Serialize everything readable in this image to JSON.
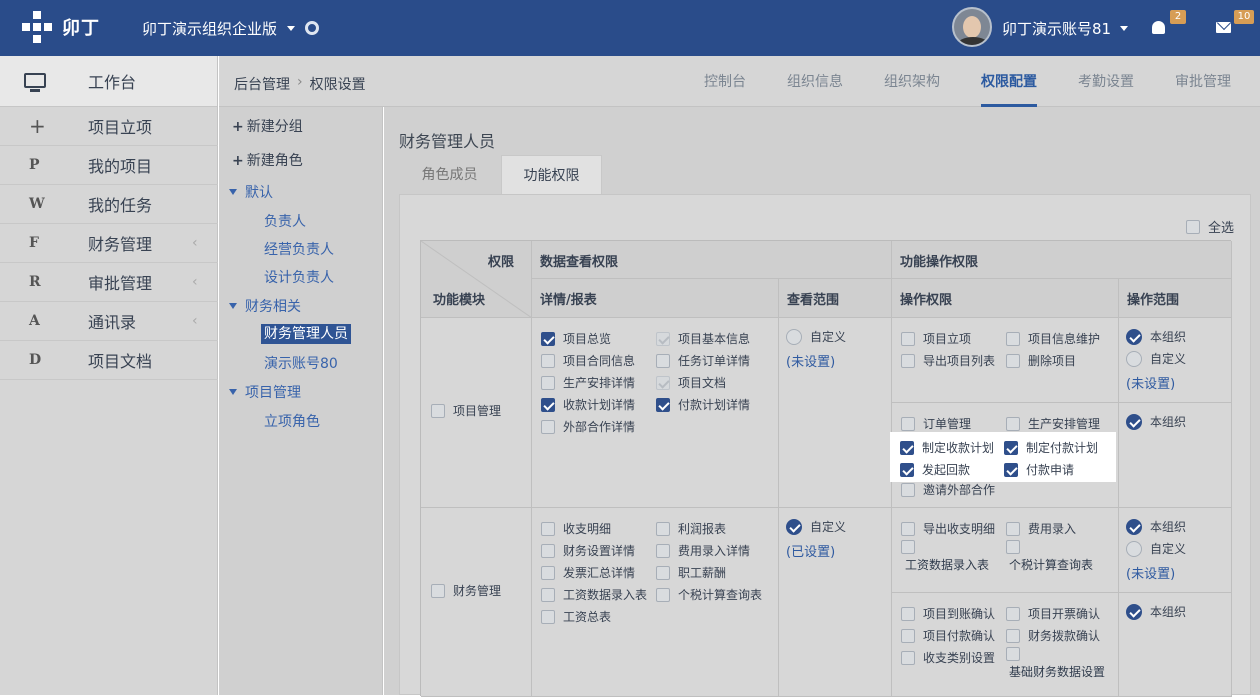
{
  "header": {
    "logo": "卯丁",
    "org": "卯丁演示组织企业版",
    "user": "卯丁演示账号81",
    "badges": {
      "bell": "2",
      "mail": "10"
    }
  },
  "sidebar": {
    "workbench": "工作台",
    "items": [
      {
        "letter": "+",
        "label": "项目立项"
      },
      {
        "letter": "P",
        "label": "我的项目"
      },
      {
        "letter": "W",
        "label": "我的任务"
      },
      {
        "letter": "F",
        "label": "财务管理",
        "caret": "‹"
      },
      {
        "letter": "R",
        "label": "审批管理",
        "caret": "‹"
      },
      {
        "letter": "A",
        "label": "通讯录",
        "caret": "‹"
      },
      {
        "letter": "D",
        "label": "项目文档"
      }
    ]
  },
  "breadcrumb": {
    "root": "后台管理",
    "sep": "›",
    "current": "权限设置"
  },
  "topTabs": [
    "控制台",
    "组织信息",
    "组织架构",
    "权限配置",
    "考勤设置",
    "审批管理"
  ],
  "tree": {
    "newGroup": "新建分组",
    "newRole": "新建角色",
    "groups": [
      {
        "label": "默认",
        "items": [
          "负责人",
          "经营负责人",
          "设计负责人"
        ]
      },
      {
        "label": "财务相关",
        "items": [
          "财务管理人员",
          "演示账号80"
        ]
      },
      {
        "label": "项目管理",
        "items": [
          "立项角色"
        ]
      }
    ]
  },
  "main": {
    "title": "财务管理人员",
    "tabs": [
      "角色成员",
      "功能权限"
    ],
    "selectAll": "全选",
    "headers": {
      "perm": "权限",
      "module": "功能模块",
      "dataView": "数据查看权限",
      "detail": "详情/报表",
      "scope": "查看范围",
      "funcOps": "功能操作权限",
      "opPerm": "操作权限",
      "opScope": "操作范围"
    },
    "rows": [
      {
        "module": "项目管理",
        "details": [
          "项目总览",
          "项目合同信息",
          "生产安排详情",
          "收款计划详情",
          "外部合作详情",
          "项目基本信息",
          "任务订单详情",
          "项目文档",
          "付款计划详情"
        ],
        "scope": "自定义",
        "scopeStatus": "(未设置)",
        "ops1": [
          "项目立项",
          "导出项目列表",
          "项目信息维护",
          "删除项目"
        ],
        "opScope1": [
          "本组织",
          "自定义"
        ],
        "opScopeStatus1": "(未设置)",
        "ops2": [
          "订单管理",
          "制定收款计划",
          "发起回款",
          "邀请外部合作",
          "生产安排管理",
          "制定付款计划",
          "付款申请"
        ],
        "opScope2": [
          "本组织"
        ]
      },
      {
        "module": "财务管理",
        "details": [
          "收支明细",
          "财务设置详情",
          "发票汇总详情",
          "工资数据录入表",
          "工资总表",
          "利润报表",
          "费用录入详情",
          "职工薪酬",
          "个税计算查询表"
        ],
        "scope": "自定义",
        "scopeStatus": "(已设置)",
        "ops1": [
          "导出收支明细",
          "工资数据录入表",
          "费用录入",
          "个税计算查询表"
        ],
        "opScope1": [
          "本组织",
          "自定义"
        ],
        "opScopeStatus1": "(未设置)",
        "ops2": [
          "项目到账确认",
          "项目付款确认",
          "收支类别设置",
          "项目开票确认",
          "财务拨款确认",
          "基础财务数据设置"
        ],
        "opScope2": [
          "本组织"
        ]
      }
    ]
  }
}
